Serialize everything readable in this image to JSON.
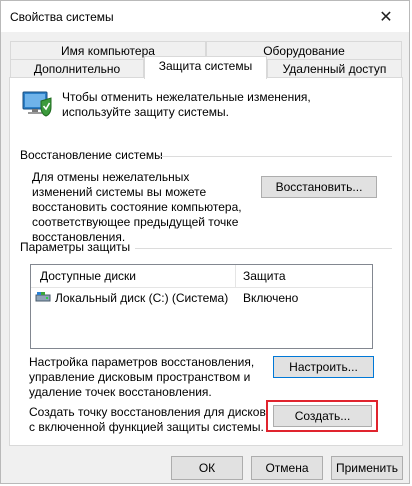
{
  "window": {
    "title": "Свойства системы",
    "close_glyph": "✕"
  },
  "tabs_row1": [
    {
      "label": "Имя компьютера"
    },
    {
      "label": "Оборудование"
    }
  ],
  "tabs_row2": [
    {
      "label": "Дополнительно"
    },
    {
      "label": "Защита системы",
      "active": true
    },
    {
      "label": "Удаленный доступ"
    }
  ],
  "intro": {
    "text": "Чтобы отменить нежелательные изменения, используйте защиту системы.",
    "icon": "system-protection-icon"
  },
  "restore_group": {
    "title": "Восстановление системы",
    "description": "Для отмены нежелательных изменений системы вы можете восстановить состояние компьютера, соответствующее предыдущей точке восстановления.",
    "button_label": "Восстановить..."
  },
  "protection_group": {
    "title": "Параметры защиты",
    "columns": [
      "Доступные диски",
      "Защита"
    ],
    "rows": [
      {
        "drive": "Локальный диск (C:) (Система)",
        "protection": "Включено",
        "icon": "drive-icon"
      }
    ],
    "configure_text": "Настройка параметров восстановления, управление дисковым пространством и удаление точек восстановления.",
    "configure_button": "Настроить...",
    "create_text": "Создать точку восстановления для дисков с включенной функцией защиты системы.",
    "create_button": "Создать..."
  },
  "footer": {
    "ok": "ОК",
    "cancel": "Отмена",
    "apply": "Применить"
  },
  "colors": {
    "highlight": "#e0242e",
    "focus": "#0078d7"
  }
}
